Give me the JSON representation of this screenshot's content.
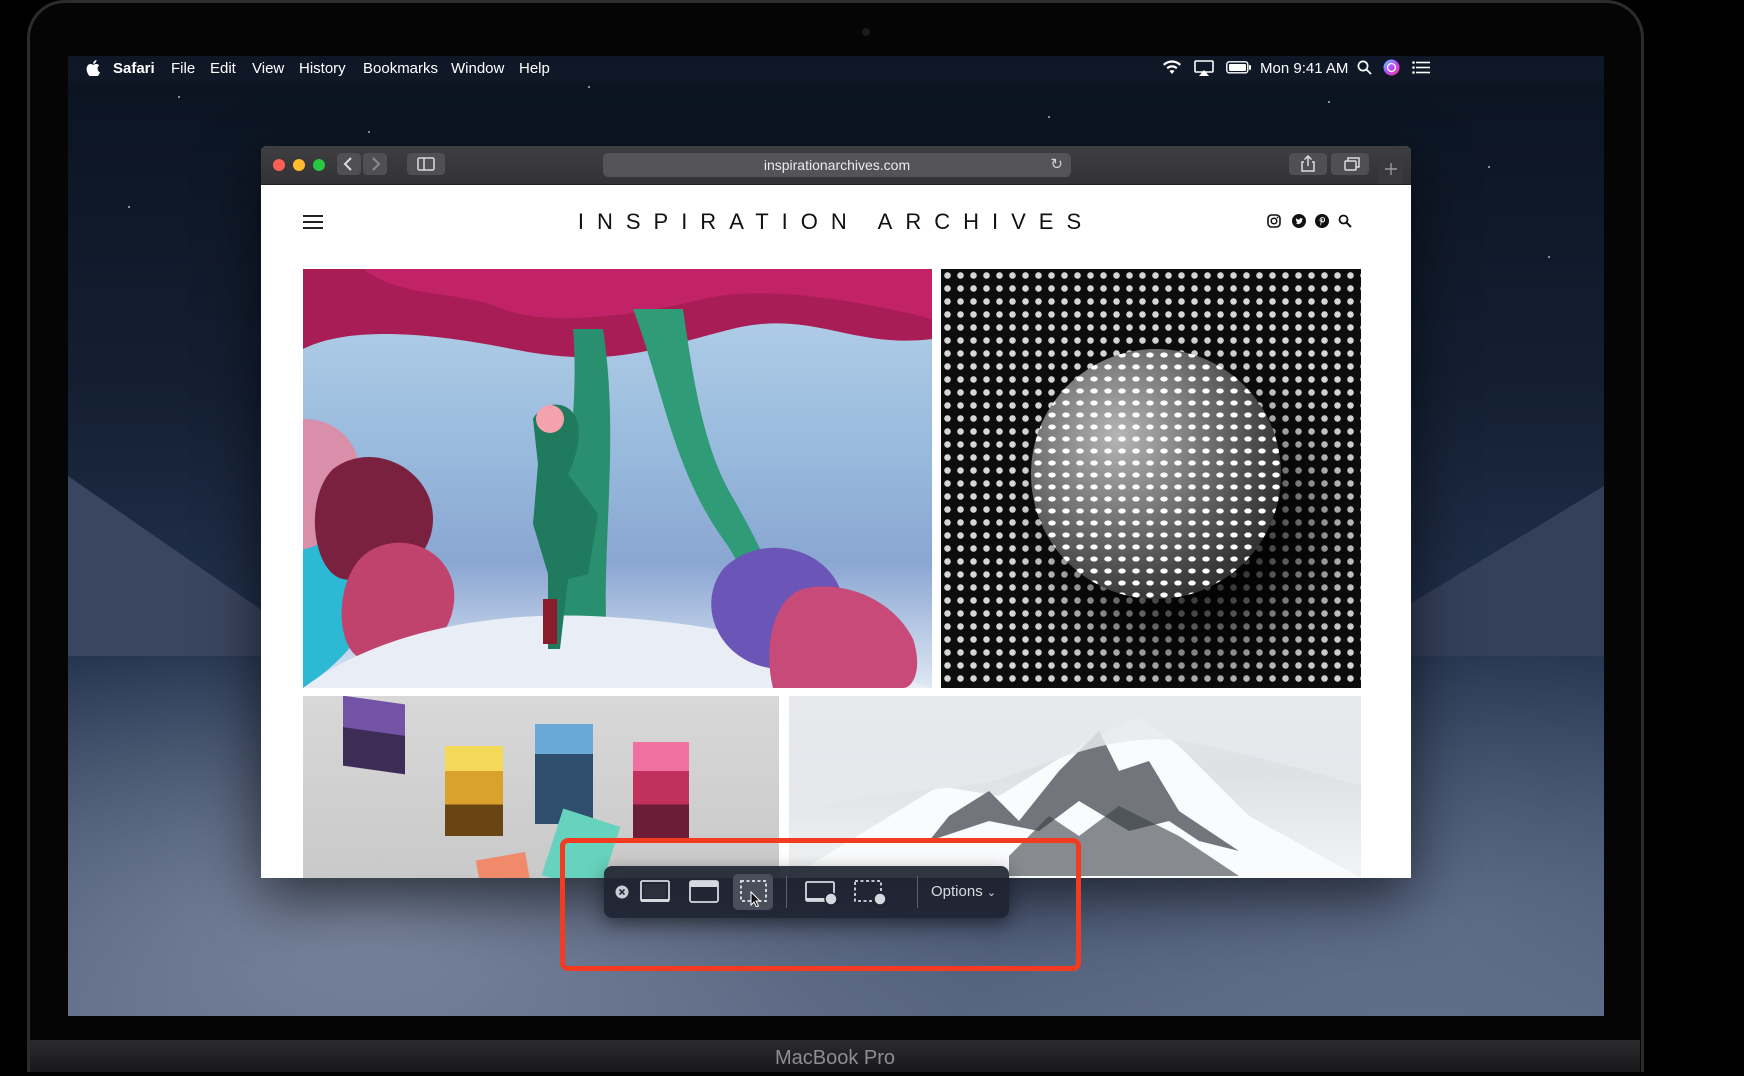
{
  "menubar": {
    "app": "Safari",
    "items": [
      "File",
      "Edit",
      "View",
      "History",
      "Bookmarks",
      "Window",
      "Help"
    ],
    "clock": "Mon 9:41 AM",
    "icons": [
      "apple-icon",
      "wifi-icon",
      "airplay-icon",
      "battery-icon",
      "spotlight-icon",
      "siri-icon",
      "notification-center-icon"
    ]
  },
  "browser": {
    "url": "inspirationarchives.com",
    "icons": [
      "back-icon",
      "forward-icon",
      "sidebar-icon",
      "reload-icon",
      "share-icon",
      "tabs-icon",
      "new-tab-icon"
    ]
  },
  "site": {
    "title": "INSPIRATION ARCHIVES",
    "social_icons": [
      "instagram-icon",
      "twitter-icon",
      "pinterest-icon",
      "search-icon"
    ]
  },
  "screenshot_toolbar": {
    "tools": [
      "close",
      "capture-entire-screen",
      "capture-window",
      "capture-selection",
      "record-entire-screen",
      "record-selection"
    ],
    "active_tool": "capture-selection",
    "options_label": "Options"
  },
  "device_label": "MacBook Pro",
  "colors": {
    "highlight": "#f23b20",
    "close": "#fe5f57",
    "minimize": "#febc2e",
    "zoom": "#28c840"
  }
}
